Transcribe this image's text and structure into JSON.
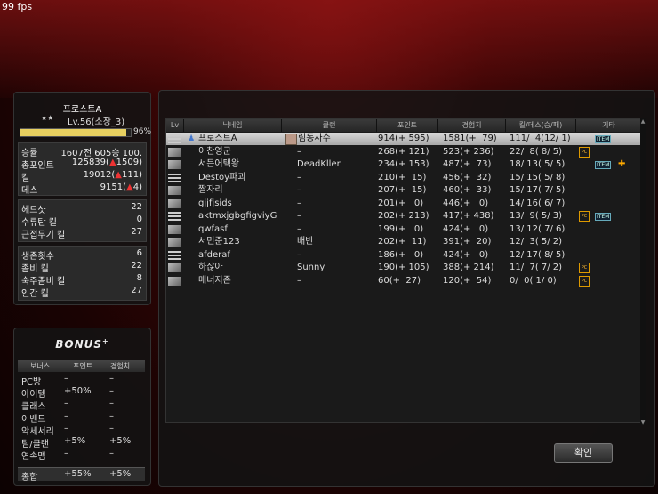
{
  "overlay": {
    "fps": "99 fps"
  },
  "profile": {
    "name": "프로스트A",
    "rank_stars": "★★",
    "level": "Lv.56(소장_3)",
    "exp_percent": 96,
    "exp_text": "96%"
  },
  "stats_main": [
    {
      "label": "승률",
      "value": "1607전 605승 100."
    },
    {
      "label": "총포인트",
      "value": "125839(",
      "delta": "1509)"
    },
    {
      "label": "킬",
      "value": "19012(",
      "delta": "111)"
    },
    {
      "label": "데스",
      "value": "9151(",
      "delta": "4)"
    }
  ],
  "stats_kills": [
    {
      "label": "헤드샷",
      "value": "22"
    },
    {
      "label": "수류탄 킬",
      "value": "0"
    },
    {
      "label": "근접무기 킬",
      "value": "27"
    }
  ],
  "stats_zombie": [
    {
      "label": "생존횟수",
      "value": "6"
    },
    {
      "label": "좀비 킬",
      "value": "22"
    },
    {
      "label": "숙주좀비 킬",
      "value": "8"
    },
    {
      "label": "인간 킬",
      "value": "27"
    }
  ],
  "bonus": {
    "title": "BONUS",
    "headers": [
      "보너스",
      "포인트",
      "경험치"
    ],
    "rows": [
      {
        "name": "PC방",
        "point": "–",
        "exp": "–"
      },
      {
        "name": "아이템",
        "point": "+50%",
        "exp": "–"
      },
      {
        "name": "클래스",
        "point": "–",
        "exp": "–"
      },
      {
        "name": "이벤트",
        "point": "–",
        "exp": "–"
      },
      {
        "name": "악세서리",
        "point": "–",
        "exp": "–"
      },
      {
        "name": "팀/클랜",
        "point": "+5%",
        "exp": "+5%"
      },
      {
        "name": "연속맵",
        "point": "–",
        "exp": "–"
      }
    ],
    "total": {
      "name": "총합",
      "point": "+55%",
      "exp": "+5%"
    }
  },
  "table": {
    "headers": [
      "Lv",
      "닉네임",
      "클랜",
      "포인트",
      "경험치",
      "킬/데스(승/패)",
      "기타"
    ],
    "players": [
      {
        "nick": "프로스트A",
        "clan": "림동사수",
        "point": "914(+ 595)",
        "exp": "1581(+  79)",
        "kd": "111/  4(12/ 1)",
        "item": true,
        "pc": false,
        "friend": false
      },
      {
        "nick": "이찬영군",
        "clan": "–",
        "point": "268(+ 121)",
        "exp": "523(+ 236)",
        "kd": "22/  8( 8/ 5)",
        "item": false,
        "pc": true,
        "friend": false
      },
      {
        "nick": "서든어택왕",
        "clan": "DeadKller",
        "point": "234(+ 153)",
        "exp": "487(+  73)",
        "kd": "18/ 13( 5/ 5)",
        "item": true,
        "pc": false,
        "friend": true
      },
      {
        "nick": "Destoy파괴",
        "clan": "–",
        "point": "210(+  15)",
        "exp": "456(+  32)",
        "kd": "15/ 15( 5/ 8)",
        "item": false,
        "pc": false,
        "friend": false
      },
      {
        "nick": "짤자리",
        "clan": "–",
        "point": "207(+  15)",
        "exp": "460(+  33)",
        "kd": "15/ 17( 7/ 5)",
        "item": false,
        "pc": false,
        "friend": false
      },
      {
        "nick": "gjjfjsids",
        "clan": "–",
        "point": "201(+   0)",
        "exp": "446(+   0)",
        "kd": "14/ 16( 6/ 7)",
        "item": false,
        "pc": false,
        "friend": false
      },
      {
        "nick": "aktmxjgbgfigviyG",
        "clan": "–",
        "point": "202(+ 213)",
        "exp": "417(+ 438)",
        "kd": "13/  9( 5/ 3)",
        "item": true,
        "pc": true,
        "friend": false
      },
      {
        "nick": "qwfasf",
        "clan": "–",
        "point": "199(+   0)",
        "exp": "424(+   0)",
        "kd": "13/ 12( 7/ 6)",
        "item": false,
        "pc": false,
        "friend": false
      },
      {
        "nick": "서민준123",
        "clan": "배반",
        "point": "202(+  11)",
        "exp": "391(+  20)",
        "kd": "12/  3( 5/ 2)",
        "item": false,
        "pc": false,
        "friend": false
      },
      {
        "nick": "afderaf",
        "clan": "–",
        "point": "186(+   0)",
        "exp": "424(+   0)",
        "kd": "12/ 17( 8/ 5)",
        "item": false,
        "pc": false,
        "friend": false
      },
      {
        "nick": "하잖아",
        "clan": "Sunny",
        "point": "190(+ 105)",
        "exp": "388(+ 214)",
        "kd": "11/  7( 7/ 2)",
        "item": false,
        "pc": true,
        "friend": false
      },
      {
        "nick": "매너지존",
        "clan": "–",
        "point": "60(+  27)",
        "exp": "120(+  54)",
        "kd": "0/  0( 1/ 0)",
        "item": false,
        "pc": true,
        "friend": false
      }
    ],
    "item_label": "ITEM",
    "pc_label": "PC"
  },
  "confirm_label": "확인",
  "colors": {
    "accent_red": "#e33333",
    "exp_bar": "#e8d060",
    "selected_row": "#c8c8c8"
  }
}
